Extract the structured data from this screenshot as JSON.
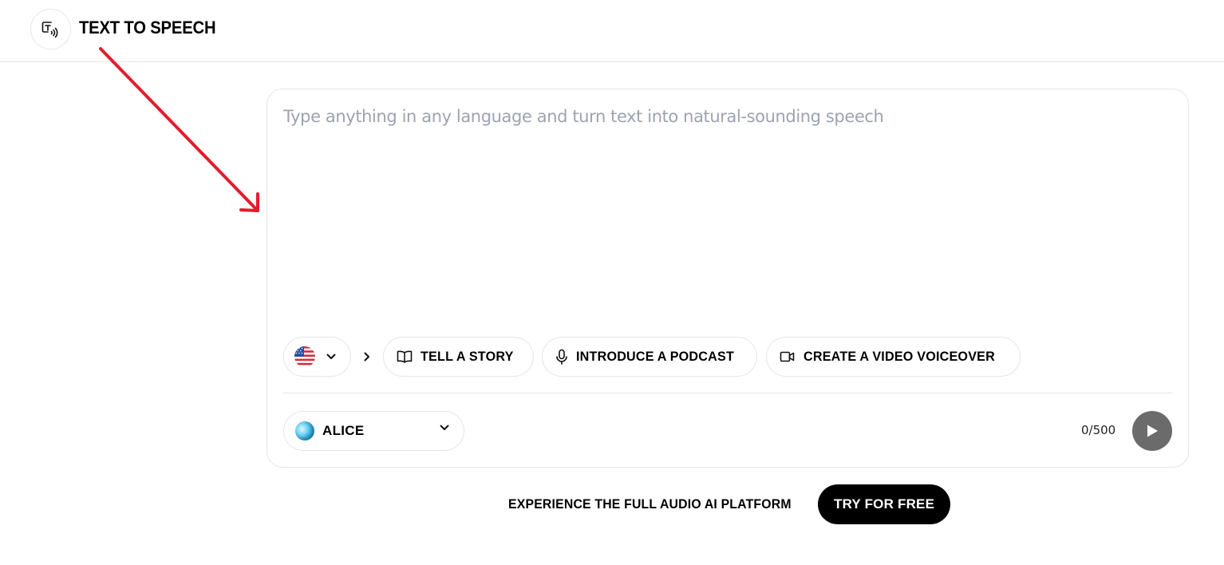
{
  "header": {
    "title": "TEXT TO SPEECH",
    "logo_icon": "text-to-speech-icon"
  },
  "annotation": {
    "arrow_icon": "red-arrow",
    "color": "#e11d2e"
  },
  "editor": {
    "placeholder": "Type anything in any language and turn text into natural-sounding speech",
    "value": ""
  },
  "language": {
    "selected_icon": "us-flag-icon"
  },
  "prompts": [
    {
      "label": "TELL A STORY",
      "icon": "book-icon"
    },
    {
      "label": "INTRODUCE A PODCAST",
      "icon": "microphone-icon"
    },
    {
      "label": "CREATE A VIDEO VOICEOVER",
      "icon": "video-camera-icon"
    }
  ],
  "voice": {
    "name": "ALICE"
  },
  "counter": {
    "text": "0/500"
  },
  "cta": {
    "text": "EXPERIENCE THE FULL AUDIO AI PLATFORM",
    "button_label": "TRY FOR FREE"
  },
  "colors": {
    "accent": "#000000",
    "play_button": "#6b6b6b",
    "placeholder": "#9ca3af",
    "border": "#e5e5e5"
  }
}
